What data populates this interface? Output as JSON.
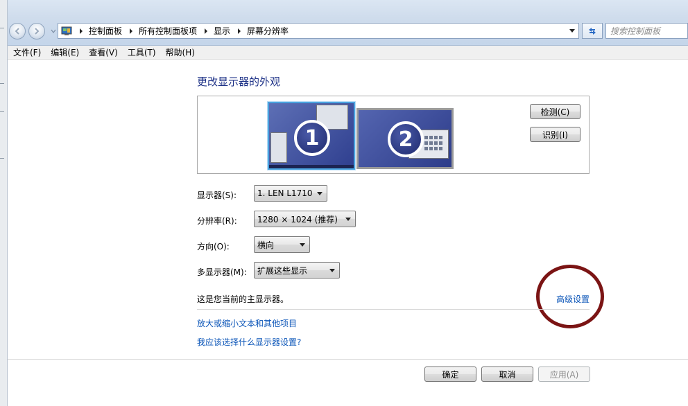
{
  "address_bar": {
    "crumbs": [
      "控制面板",
      "所有控制面板项",
      "显示",
      "屏幕分辨率"
    ],
    "search_placeholder": "搜索控制面板"
  },
  "menu": {
    "items": [
      "文件(F)",
      "编辑(E)",
      "查看(V)",
      "工具(T)",
      "帮助(H)"
    ]
  },
  "main": {
    "title": "更改显示器的外观",
    "monitors": [
      {
        "number": "1",
        "selected": true
      },
      {
        "number": "2",
        "selected": false
      }
    ],
    "detect_label": "检测(C)",
    "identify_label": "识别(I)",
    "display_label": "显示器(S):",
    "display_value": "1. LEN L1710",
    "resolution_label": "分辨率(R):",
    "resolution_value": "1280 × 1024 (推荐)",
    "orientation_label": "方向(O):",
    "orientation_value": "横向",
    "multi_label": "多显示器(M):",
    "multi_value": "扩展这些显示",
    "status_text": "这是您当前的主显示器。",
    "advanced_link": "高级设置",
    "link_text_size": "放大或缩小文本和其他项目",
    "link_which_settings": "我应该选择什么显示器设置?"
  },
  "footer": {
    "ok_label": "确定",
    "cancel_label": "取消",
    "apply_label": "应用(A)"
  },
  "colors": {
    "title_blue": "#1e3287",
    "link_blue": "#0b55b8",
    "annotation_circle": "#7b1414"
  }
}
